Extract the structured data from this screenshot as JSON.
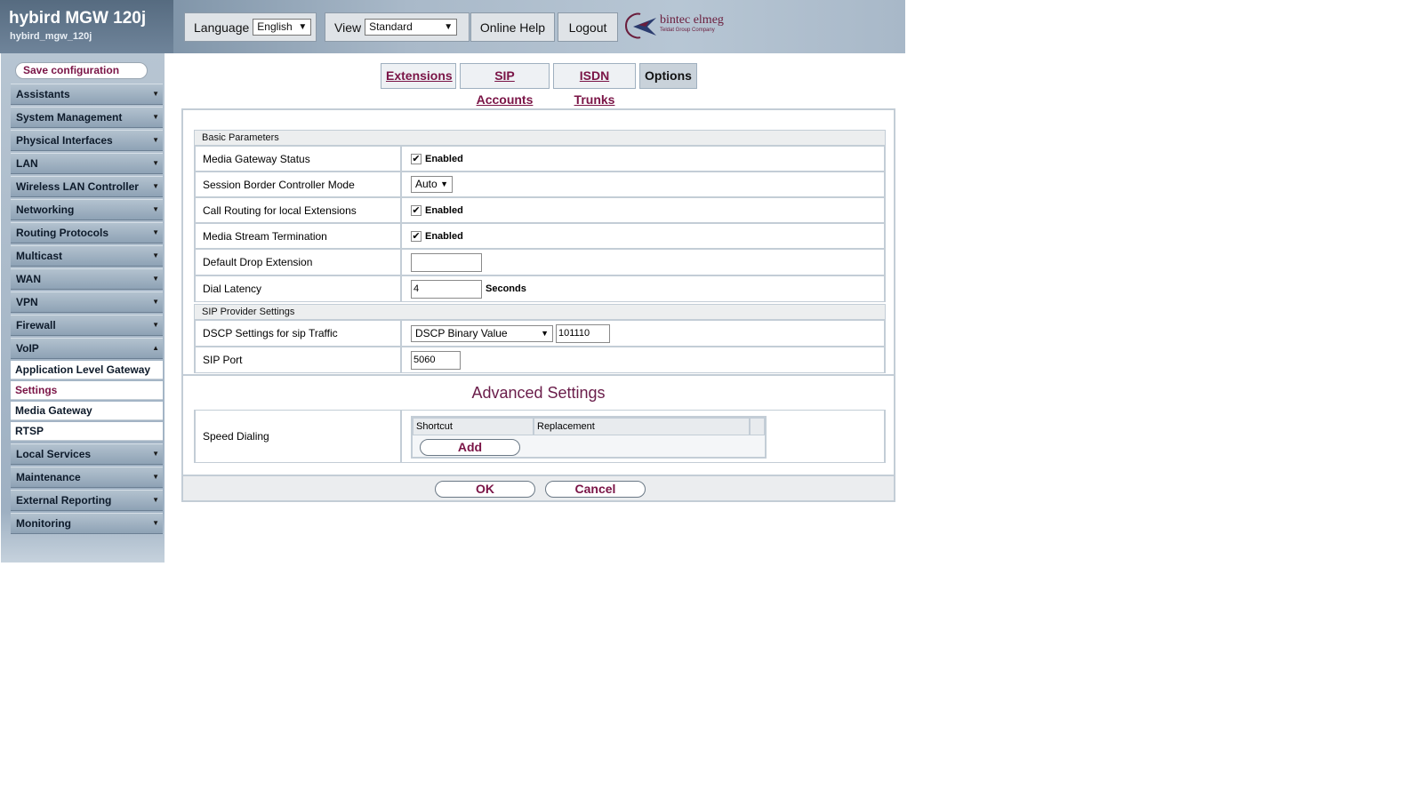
{
  "header": {
    "title": "hybird MGW 120j",
    "hostname": "hybird_mgw_120j",
    "language_label": "Language",
    "language_value": "English",
    "view_label": "View",
    "view_value": "Standard",
    "online_help": "Online Help",
    "logout": "Logout",
    "logo_text": "bintec elmeg",
    "logo_sub": "Teldat Group Company"
  },
  "sidebar": {
    "save_configuration": "Save configuration",
    "items": [
      "Assistants",
      "System Management",
      "Physical Interfaces",
      "LAN",
      "Wireless LAN Controller",
      "Networking",
      "Routing Protocols",
      "Multicast",
      "WAN",
      "VPN",
      "Firewall",
      "VoIP"
    ],
    "voip_sub": [
      "Application Level Gateway",
      "Settings",
      "Media Gateway",
      "RTSP"
    ],
    "items_after": [
      "Local Services",
      "Maintenance",
      "External Reporting",
      "Monitoring"
    ]
  },
  "tabs": [
    "Extensions",
    "SIP Accounts",
    "ISDN Trunks",
    "Options"
  ],
  "basic": {
    "section": "Basic Parameters",
    "mgw_status_label": "Media Gateway Status",
    "mgw_status_value": "Enabled",
    "sbc_mode_label": "Session Border Controller Mode",
    "sbc_mode_value": "Auto",
    "call_routing_label": "Call Routing for local Extensions",
    "call_routing_value": "Enabled",
    "stream_term_label": "Media Stream Termination",
    "stream_term_value": "Enabled",
    "default_drop_label": "Default Drop Extension",
    "default_drop_value": "",
    "dial_latency_label": "Dial Latency",
    "dial_latency_value": "4",
    "dial_latency_unit": "Seconds"
  },
  "sip": {
    "section": "SIP Provider Settings",
    "dscp_label": "DSCP Settings for sip Traffic",
    "dscp_select": "DSCP Binary Value",
    "dscp_value": "101110",
    "port_label": "SIP Port",
    "port_value": "5060"
  },
  "advanced": {
    "title": "Advanced Settings",
    "speed_dial_label": "Speed Dialing",
    "col_shortcut": "Shortcut",
    "col_replacement": "Replacement",
    "add": "Add"
  },
  "footer": {
    "ok": "OK",
    "cancel": "Cancel"
  }
}
